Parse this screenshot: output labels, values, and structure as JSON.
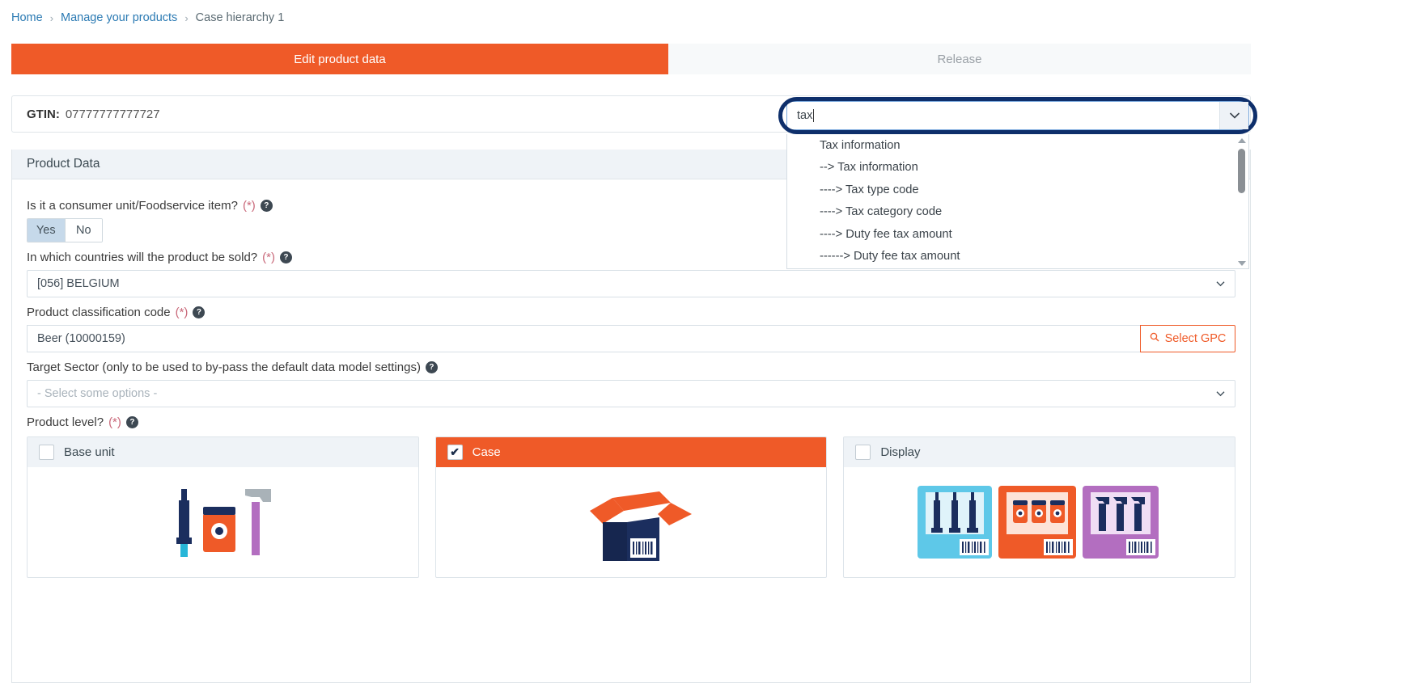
{
  "breadcrumb": {
    "items": [
      {
        "label": "Home",
        "current": false
      },
      {
        "label": "Manage your products",
        "current": false
      },
      {
        "label": "Case hierarchy 1",
        "current": true
      }
    ],
    "separator": "›"
  },
  "tabs": [
    {
      "label": "Edit product data",
      "active": true
    },
    {
      "label": "Release",
      "active": false
    }
  ],
  "gtin": {
    "label": "GTIN:",
    "value": "07777777777727"
  },
  "panel": {
    "title": "Product Data"
  },
  "form": {
    "consumer_unit": {
      "label": "Is it a consumer unit/Foodservice item?",
      "required_marker": "(*)",
      "help_icon": "question-mark-icon",
      "options": [
        "Yes",
        "No"
      ],
      "selected": "Yes"
    },
    "countries": {
      "label": "In which countries will the product be sold?",
      "required_marker": "(*)",
      "value": "[056] BELGIUM"
    },
    "classification": {
      "label": "Product classification code",
      "required_marker": "(*)",
      "value": "Beer (10000159)",
      "button_label": "Select GPC",
      "button_icon": "search-icon"
    },
    "target_sector": {
      "label": "Target Sector (only to be used to by-pass the default data model settings)",
      "placeholder": "- Select some options -"
    },
    "product_level": {
      "label": "Product level?",
      "required_marker": "(*)",
      "cards": [
        {
          "label": "Base unit",
          "selected": false,
          "icon": "base-unit-illustration"
        },
        {
          "label": "Case",
          "selected": true,
          "icon": "case-box-illustration"
        },
        {
          "label": "Display",
          "selected": false,
          "icon": "display-pallet-illustration"
        }
      ],
      "checkmark": "✔"
    }
  },
  "attribute_search": {
    "value": "tax",
    "chevron_icon": "chevron-down-icon",
    "options": [
      "Tax information",
      "--> Tax information",
      "----> Tax type code",
      "----> Tax category code",
      "----> Duty fee tax amount",
      "------> Duty fee tax amount"
    ],
    "scrollbar": {
      "up_icon": "scroll-up-arrow-icon",
      "down_icon": "scroll-down-arrow-icon"
    }
  },
  "colors": {
    "accent_orange": "#ef5a28",
    "focus_navy": "#0e2f6b",
    "link_blue": "#2b7ab3",
    "panel_head": "#eff3f7"
  }
}
